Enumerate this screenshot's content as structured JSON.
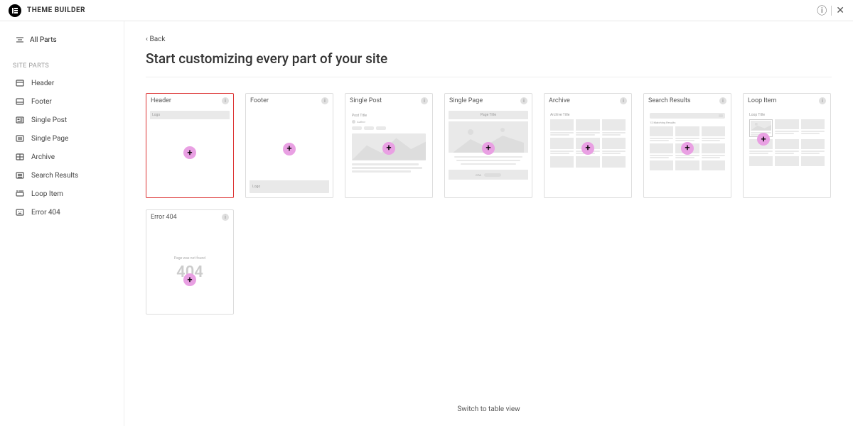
{
  "topbar": {
    "title": "THEME BUILDER"
  },
  "sidebar": {
    "all_parts": "All Parts",
    "heading": "SITE PARTS",
    "items": [
      {
        "label": "Header"
      },
      {
        "label": "Footer"
      },
      {
        "label": "Single Post"
      },
      {
        "label": "Single Page"
      },
      {
        "label": "Archive"
      },
      {
        "label": "Search Results"
      },
      {
        "label": "Loop Item"
      },
      {
        "label": "Error 404"
      }
    ]
  },
  "main": {
    "back": "Back",
    "title": "Start customizing every part of your site",
    "switch_view": "Switch to table view"
  },
  "cards": [
    {
      "title": "Header",
      "selected": true,
      "kind": "header"
    },
    {
      "title": "Footer",
      "kind": "footer"
    },
    {
      "title": "Single Post",
      "kind": "single_post",
      "preview_title": "Post Title",
      "preview_author": "Author"
    },
    {
      "title": "Single Page",
      "kind": "single_page",
      "preview_title": "Page Title",
      "cta": "CTA"
    },
    {
      "title": "Archive",
      "kind": "archive",
      "preview_title": "Archive Title"
    },
    {
      "title": "Search Results",
      "kind": "search",
      "matching": "12 Matching Results"
    },
    {
      "title": "Loop Item",
      "kind": "loop",
      "preview_title": "Loop Title"
    },
    {
      "title": "Error 404",
      "kind": "e404",
      "msg": "Page was not found",
      "code": "404"
    }
  ]
}
